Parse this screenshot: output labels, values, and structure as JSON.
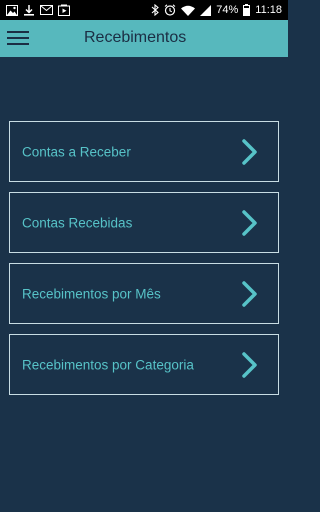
{
  "status_bar": {
    "battery": "74%",
    "time": "11:18"
  },
  "app_bar": {
    "title": "Recebimentos",
    "menu_icon": "hamburger-menu-icon"
  },
  "menu": {
    "items": [
      {
        "label": "Contas a Receber",
        "icon": "chevron-right-icon"
      },
      {
        "label": "Contas Recebidas",
        "icon": "chevron-right-icon"
      },
      {
        "label": "Recebimentos por Mês",
        "icon": "chevron-right-icon"
      },
      {
        "label": "Recebimentos por Categoria",
        "icon": "chevron-right-icon"
      }
    ]
  },
  "colors": {
    "background": "#1a3249",
    "app_bar": "#57b8bd",
    "accent": "#57c3c8",
    "border": "#c8dde4"
  }
}
